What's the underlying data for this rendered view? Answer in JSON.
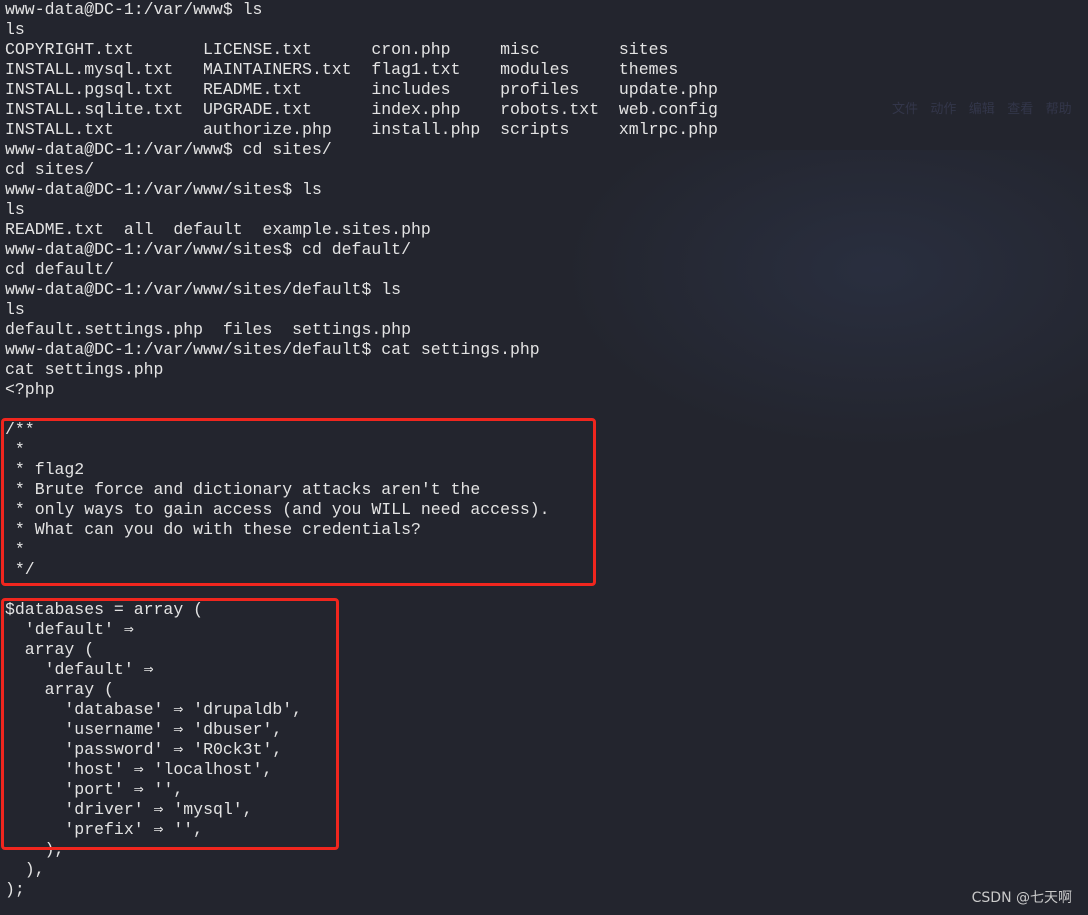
{
  "terminal": {
    "lines": [
      "www-data@DC-1:/var/www$ ls",
      "ls",
      "COPYRIGHT.txt       LICENSE.txt      cron.php     misc        sites",
      "INSTALL.mysql.txt   MAINTAINERS.txt  flag1.txt    modules     themes",
      "INSTALL.pgsql.txt   README.txt       includes     profiles    update.php",
      "INSTALL.sqlite.txt  UPGRADE.txt      index.php    robots.txt  web.config",
      "INSTALL.txt         authorize.php    install.php  scripts     xmlrpc.php",
      "www-data@DC-1:/var/www$ cd sites/",
      "cd sites/",
      "www-data@DC-1:/var/www/sites$ ls",
      "ls",
      "README.txt  all  default  example.sites.php",
      "www-data@DC-1:/var/www/sites$ cd default/",
      "cd default/",
      "www-data@DC-1:/var/www/sites/default$ ls",
      "ls",
      "default.settings.php  files  settings.php",
      "www-data@DC-1:/var/www/sites/default$ cat settings.php",
      "cat settings.php",
      "<?php",
      "",
      "/**",
      " *",
      " * flag2",
      " * Brute force and dictionary attacks aren't the",
      " * only ways to gain access (and you WILL need access).",
      " * What can you do with these credentials?",
      " *",
      " */",
      "",
      "$databases = array (",
      "  'default' ⇒",
      "  array (",
      "    'default' ⇒",
      "    array (",
      "      'database' ⇒ 'drupaldb',",
      "      'username' ⇒ 'dbuser',",
      "      'password' ⇒ 'R0ck3t',",
      "      'host' ⇒ 'localhost',",
      "      'port' ⇒ '',",
      "      'driver' ⇒ 'mysql',",
      "      'prefix' ⇒ '',",
      "    ),",
      "  ),",
      ");"
    ]
  },
  "background_window": {
    "menu": "文件   动作   编辑   查看   帮助"
  },
  "watermark": "CSDN @七天啊",
  "colors": {
    "background": "#23252e",
    "text": "#e3e3e3",
    "highlight_box": "#f0261e"
  }
}
